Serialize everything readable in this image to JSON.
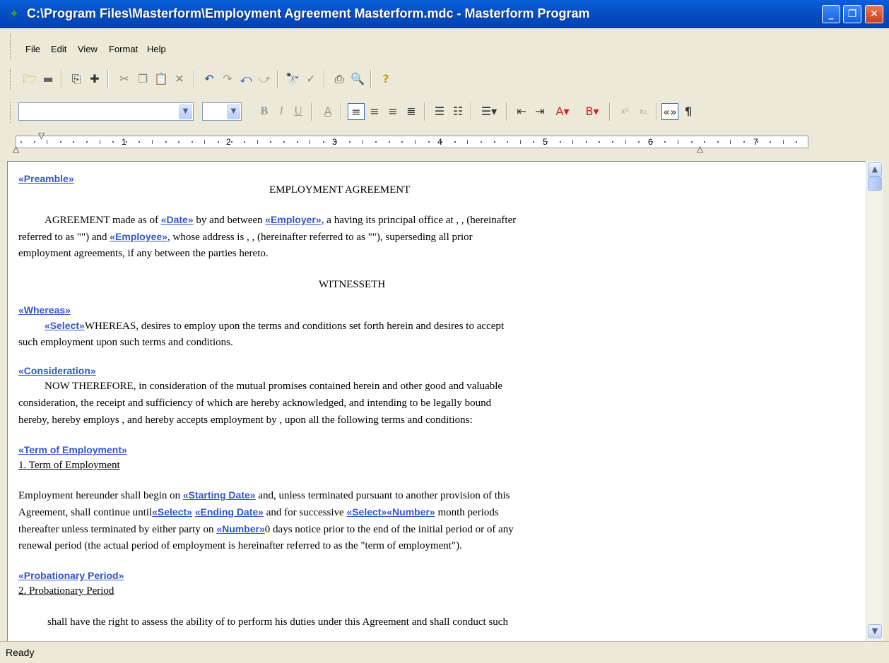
{
  "window": {
    "title": "C:\\Program Files\\Masterform\\Employment Agreement Masterform.mdc - Masterform Program",
    "minimize": "_",
    "maximize": "❐",
    "close": "✕"
  },
  "menu": [
    "File",
    "Edit",
    "View",
    "Format",
    "Help"
  ],
  "format_toolbar": {
    "font_name": "",
    "font_size": "",
    "bold": "B",
    "italic": "I",
    "underline": "U",
    "font_color": "A",
    "highlight": "B",
    "pilcrow": "¶"
  },
  "ruler": {
    "numbers": [
      "1",
      "2",
      "3",
      "4",
      "5",
      "6",
      "7"
    ]
  },
  "document": {
    "preamble_field": "«Preamble»",
    "title": "EMPLOYMENT AGREEMENT",
    "p1_a": "AGREEMENT made as of ",
    "date_field": "«Date»",
    "p1_b": " by and between ",
    "employer_field": "«Employer»,",
    "p1_c": " a   having its principal office at , ,  (hereinafter",
    "p1_d": "referred to as \"\") and ",
    "employee_field": "«Employee»",
    "p1_e": ", whose address is , ,  (hereinafter referred to as \"\"), superseding all prior",
    "p1_f": "employment agreements, if any between the parties hereto.",
    "witnesseth": "WITNESSETH",
    "whereas_field": "«Whereas»",
    "select_field": "«Select»",
    "p2_a": "WHEREAS,  desires to employ  upon the terms and conditions set forth herein and  desires to accept",
    "p2_b": "such employment upon such terms and conditions.",
    "consideration_field": "«Consideration»",
    "p3_a": "NOW THEREFORE, in consideration of the mutual promises contained herein and other good and valuable",
    "p3_b": "consideration, the receipt and sufficiency of which are hereby acknowledged, and intending to be legally bound",
    "p3_c": "hereby,  hereby employs , and  hereby accepts employment by , upon all the following terms and conditions:",
    "term_field": "«Term of Employment»",
    "term_heading": "1. Term of Employment",
    "p4_a": "Employment hereunder shall begin on ",
    "starting_date_field": "«Starting Date»",
    "p4_b": " and, unless terminated pursuant to another provision of this",
    "p4_c": "Agreement, shall continue until",
    "select_field2": "«Select»",
    "ending_date_field": "«Ending Date»",
    "p4_d": " and for successive ",
    "select_field3": "«Select»",
    "number_field": "«Number»",
    "p4_e": " month periods",
    "p4_f": "thereafter unless terminated by either party on ",
    "number_field2": "«Number»",
    "p4_g": "0 days notice prior to the end of the initial period or of any",
    "p4_h": "renewal period (the actual period of  employment is hereinafter referred to as the \"term of employment\").",
    "probation_field": "«Probationary Period»",
    "probation_heading": "2. Probationary Period",
    "p5_a": "shall have the right to assess the ability of  to perform his duties under this Agreement and shall conduct such"
  },
  "status": {
    "text": "Ready"
  }
}
